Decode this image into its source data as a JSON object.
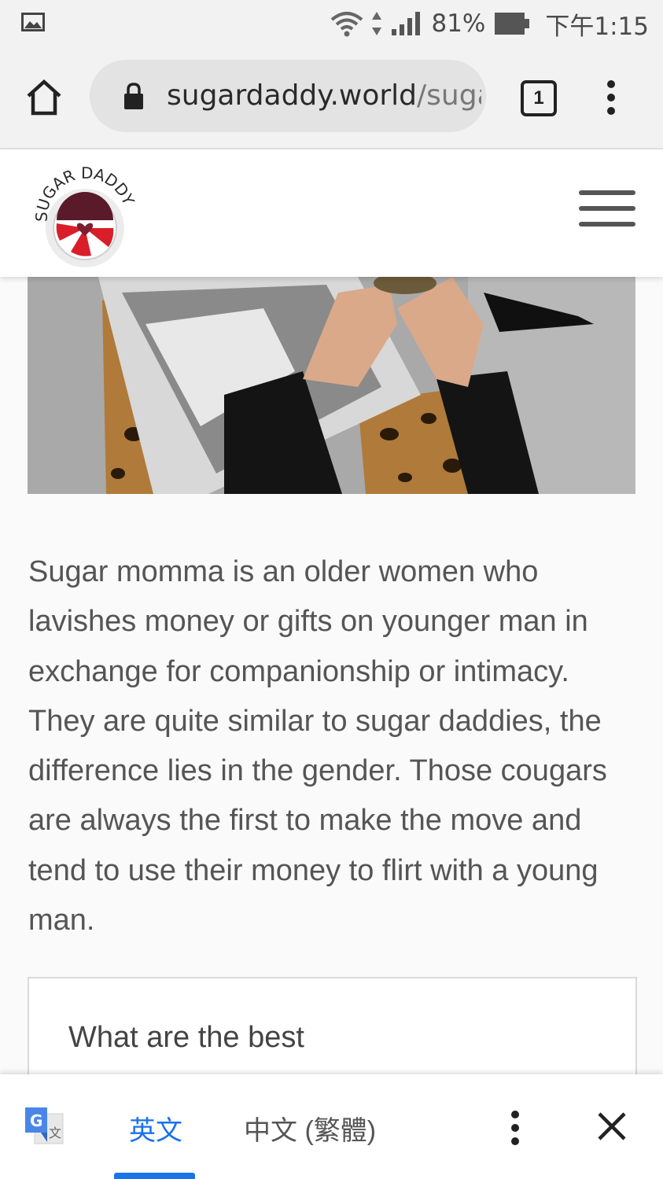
{
  "status_bar": {
    "battery": "81%",
    "time": "下午1:15",
    "icons": [
      "photo-icon",
      "wifi-icon",
      "data-arrows-icon",
      "signal-icon",
      "battery-icon"
    ]
  },
  "browser": {
    "url_domain": "sugardaddy.world",
    "url_path": "/suga",
    "tab_count": "1",
    "icons": [
      "home-icon",
      "lock-icon",
      "tab-switcher-icon",
      "overflow-menu-icon"
    ]
  },
  "site": {
    "logo_text": "SUGAR DADDY",
    "icons": [
      "hamburger-menu-icon"
    ]
  },
  "article": {
    "paragraph": "Sugar momma is an older women who lavishes money or gifts on younger man in exchange for companionship or intimacy. They are quite similar to sugar daddies, the difference lies in the gender. Those cougars are always the first to make the move and tend to use their money to flirt with a young man.",
    "toc_title": "What are the best"
  },
  "translate_bar": {
    "source_lang": "英文",
    "target_lang": "中文 (繁體)",
    "icons": [
      "google-translate-icon",
      "more-options-icon",
      "close-icon"
    ]
  },
  "colors": {
    "accent": "#1a73e8",
    "status_bg": "#f2f2f2",
    "url_pill": "#e3e3e3",
    "text": "#555555"
  }
}
